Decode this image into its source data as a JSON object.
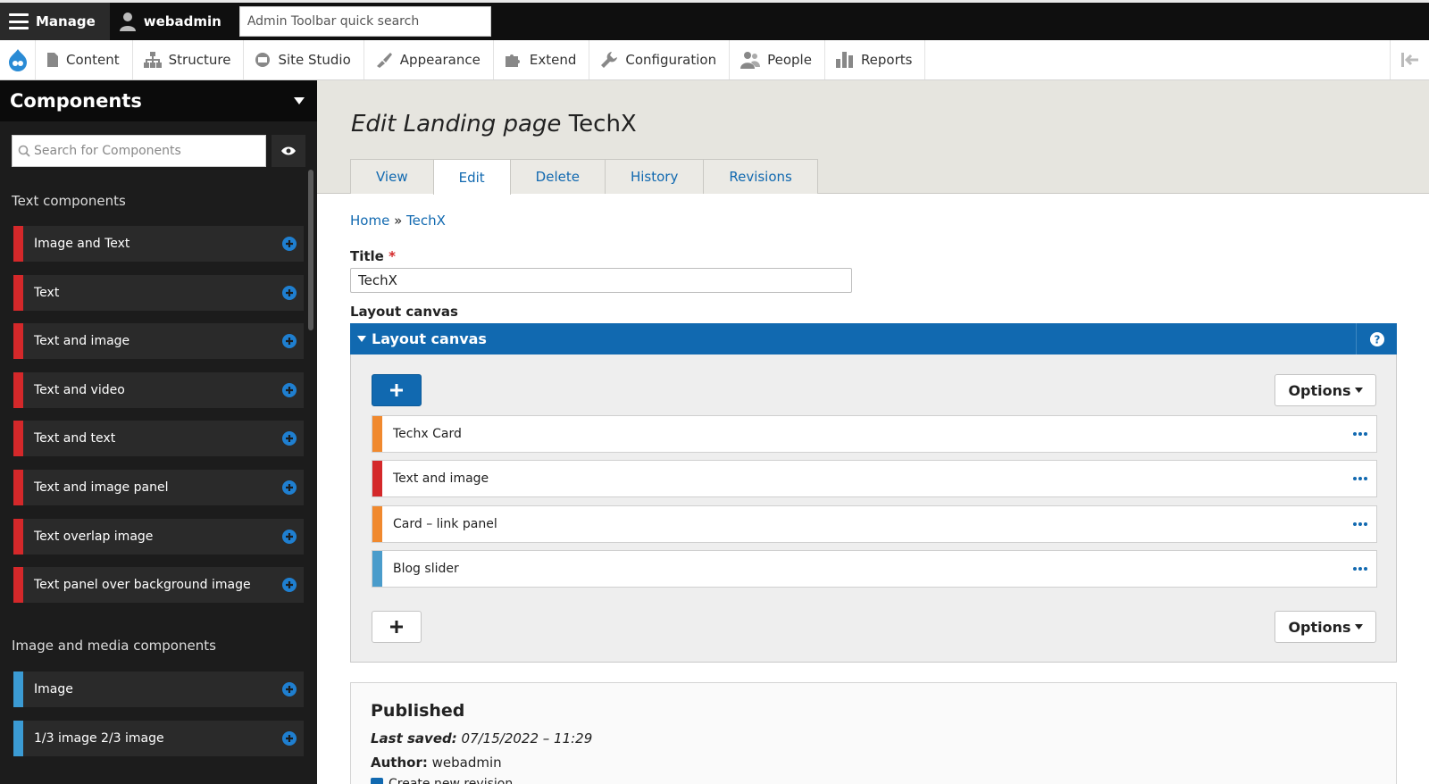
{
  "toolbar": {
    "manage_label": "Manage",
    "user_label": "webadmin",
    "search_placeholder": "Admin Toolbar quick search"
  },
  "menu": {
    "items": [
      {
        "label": "Content",
        "icon": "file-icon"
      },
      {
        "label": "Structure",
        "icon": "sitemap-icon"
      },
      {
        "label": "Site Studio",
        "icon": "site-studio-icon"
      },
      {
        "label": "Appearance",
        "icon": "paintbrush-icon"
      },
      {
        "label": "Extend",
        "icon": "puzzle-icon"
      },
      {
        "label": "Configuration",
        "icon": "wrench-icon"
      },
      {
        "label": "People",
        "icon": "people-icon"
      },
      {
        "label": "Reports",
        "icon": "bar-chart-icon"
      }
    ]
  },
  "sidebar": {
    "title": "Components",
    "search_placeholder": "Search for Components",
    "sections": [
      {
        "heading": "Text components",
        "items": [
          {
            "label": "Image and Text",
            "color": "#d4282a"
          },
          {
            "label": "Text",
            "color": "#d4282a"
          },
          {
            "label": "Text and image",
            "color": "#d4282a"
          },
          {
            "label": "Text and video",
            "color": "#d4282a"
          },
          {
            "label": "Text and text",
            "color": "#d4282a"
          },
          {
            "label": "Text and image panel",
            "color": "#d4282a"
          },
          {
            "label": "Text overlap image",
            "color": "#d4282a"
          },
          {
            "label": "Text panel over background image",
            "color": "#d4282a"
          }
        ]
      },
      {
        "heading": "Image and media components",
        "items": [
          {
            "label": "Image",
            "color": "#3b9bd4"
          },
          {
            "label": "1/3 image 2/3 image",
            "color": "#3b9bd4"
          }
        ]
      }
    ]
  },
  "page": {
    "title_prefix": "Edit Landing page",
    "title_name": "TechX",
    "tabs": [
      "View",
      "Edit",
      "Delete",
      "History",
      "Revisions"
    ],
    "active_tab": "Edit",
    "breadcrumb": {
      "home": "Home",
      "separator": "»",
      "current": "TechX"
    }
  },
  "form": {
    "title_label": "Title",
    "required_mark": "*",
    "title_value": "TechX",
    "canvas_label": "Layout canvas",
    "canvas_header": "Layout canvas",
    "options_label": "Options",
    "components": [
      {
        "label": "Techx Card",
        "color": "#f0892e"
      },
      {
        "label": "Text and image",
        "color": "#d4282a"
      },
      {
        "label": "Card – link panel",
        "color": "#f0892e"
      },
      {
        "label": "Blog slider",
        "color": "#4a9ccb"
      }
    ]
  },
  "published": {
    "heading": "Published",
    "last_saved_label": "Last saved:",
    "last_saved_value": "07/15/2022 – 11:29",
    "author_label": "Author:",
    "author_value": "webadmin",
    "revision_label": "Create new revision"
  },
  "colors": {
    "accent": "#1169b0",
    "text_red": "#d4282a",
    "orange": "#f0892e",
    "blue": "#3b9bd4"
  }
}
